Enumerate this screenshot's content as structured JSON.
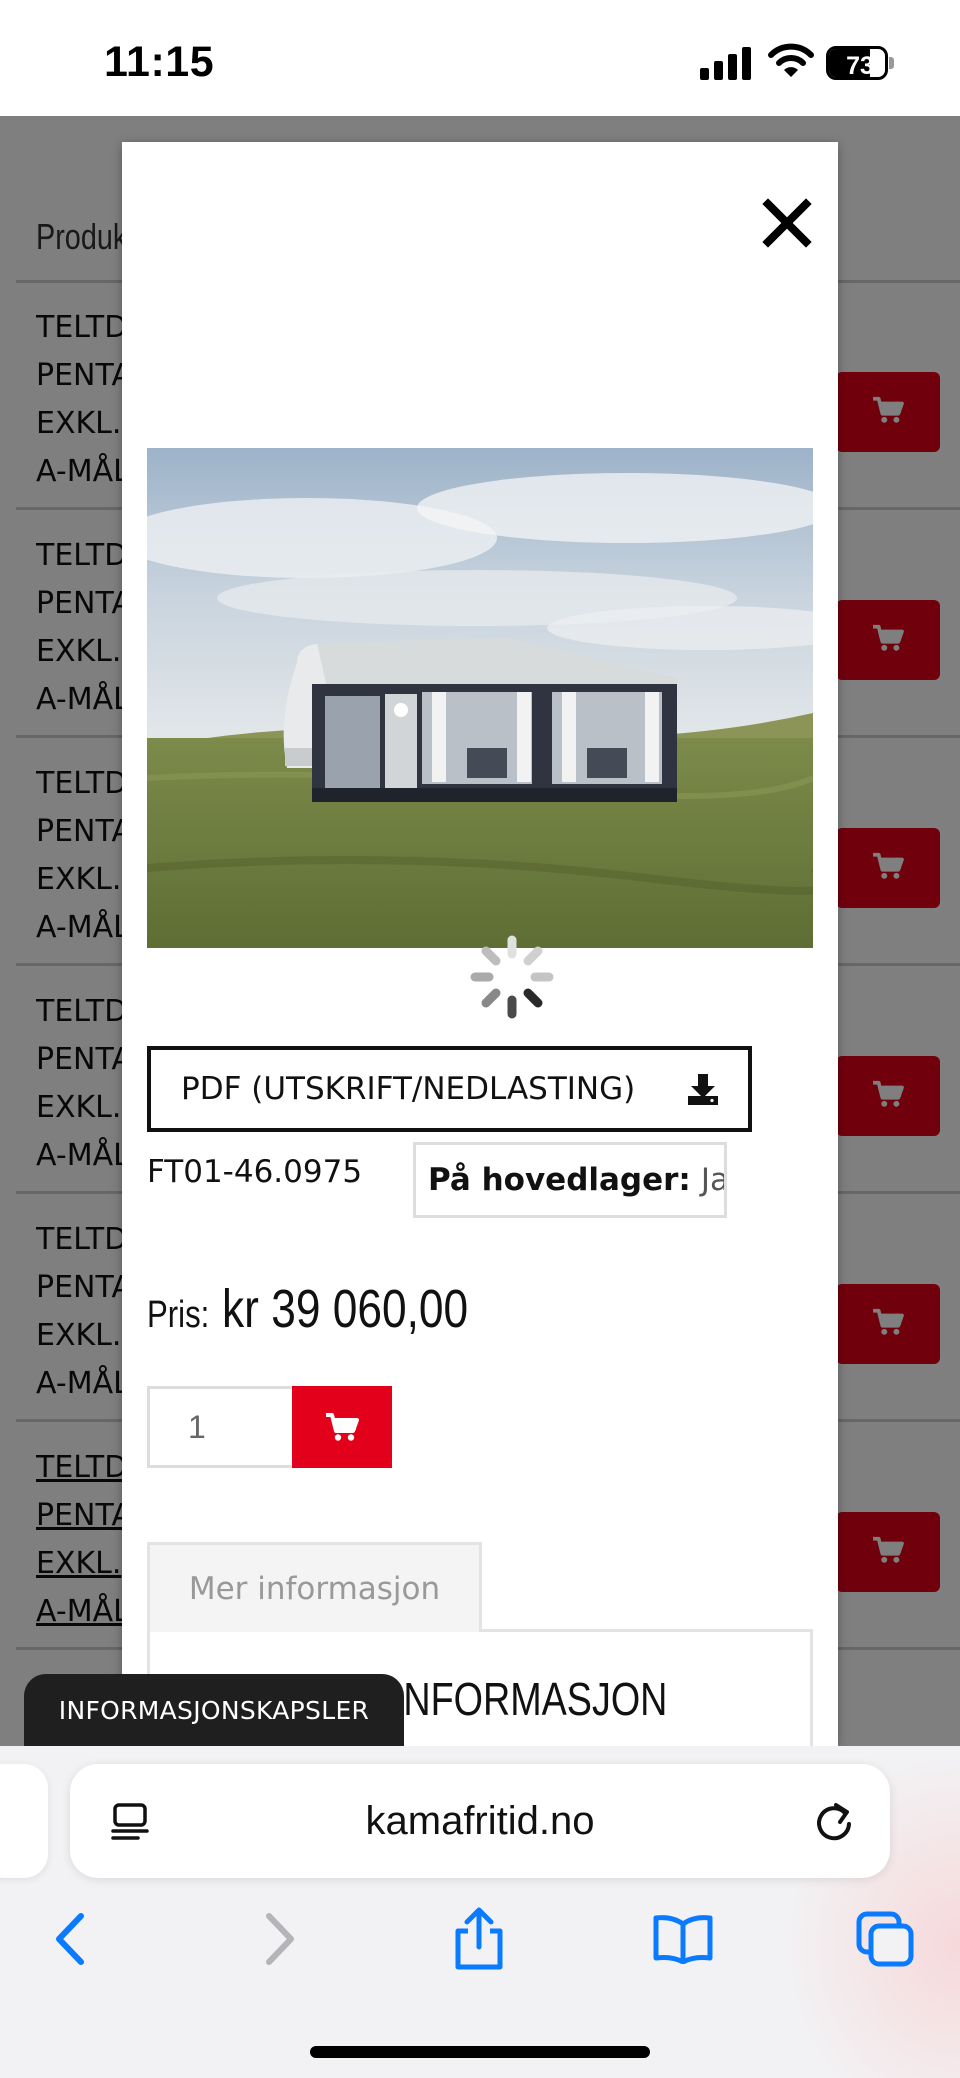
{
  "status_bar": {
    "time": "11:15",
    "battery": "73",
    "battery_level": 0.73
  },
  "background_page": {
    "column_header": "Produkt",
    "rows": [
      {
        "lines": [
          "TELTDUK",
          "PENTA",
          "EXKL.",
          "A-MÅL"
        ]
      },
      {
        "lines": [
          "TELTDUK",
          "PENTA",
          "EXKL.",
          "A-MÅL"
        ]
      },
      {
        "lines": [
          "TELTDUK",
          "PENTA",
          "EXKL.",
          "A-MÅL"
        ]
      },
      {
        "lines": [
          "TELTDUK",
          "PENTA",
          "EXKL.",
          "A-MÅL"
        ]
      },
      {
        "lines": [
          "TELTDUK",
          "PENTA",
          "EXKL.",
          "A-MÅL"
        ]
      },
      {
        "lines": [
          "TELTDUK",
          "PENTA",
          "EXKL.",
          "A-MÅL"
        ]
      }
    ],
    "cart_icon": "shopping-cart-icon"
  },
  "modal": {
    "close_icon": "close-icon",
    "image_alt": "Caravan awning tent on grassy dune",
    "pdf_button_label": "PDF (UTSKRIFT/NEDLASTING)",
    "pdf_icon": "download-icon",
    "sku": "FT01-46.0975",
    "stock_label": "På hovedlager:",
    "stock_value": "Ja",
    "price_label": "Pris:",
    "price_value": "kr 39 060,00",
    "quantity_value": "1",
    "add_to_cart_icon": "shopping-cart-icon",
    "tab_label": "Mer informasjon",
    "tab_panel_heading": "MER INFORMASJON"
  },
  "cookie_toast": {
    "label": "INFORMASJONSKAPSLER"
  },
  "safari": {
    "url": "kamafritid.no",
    "reader_icon": "reader-mode-icon",
    "reload_icon": "reload-icon",
    "toolbar": [
      "back-icon",
      "forward-icon",
      "share-icon",
      "bookmarks-icon",
      "tabs-icon"
    ]
  },
  "colors": {
    "accent_red": "#e2001a",
    "safari_blue": "#0a7aff",
    "overlay": "rgba(0,0,0,0.5)"
  }
}
